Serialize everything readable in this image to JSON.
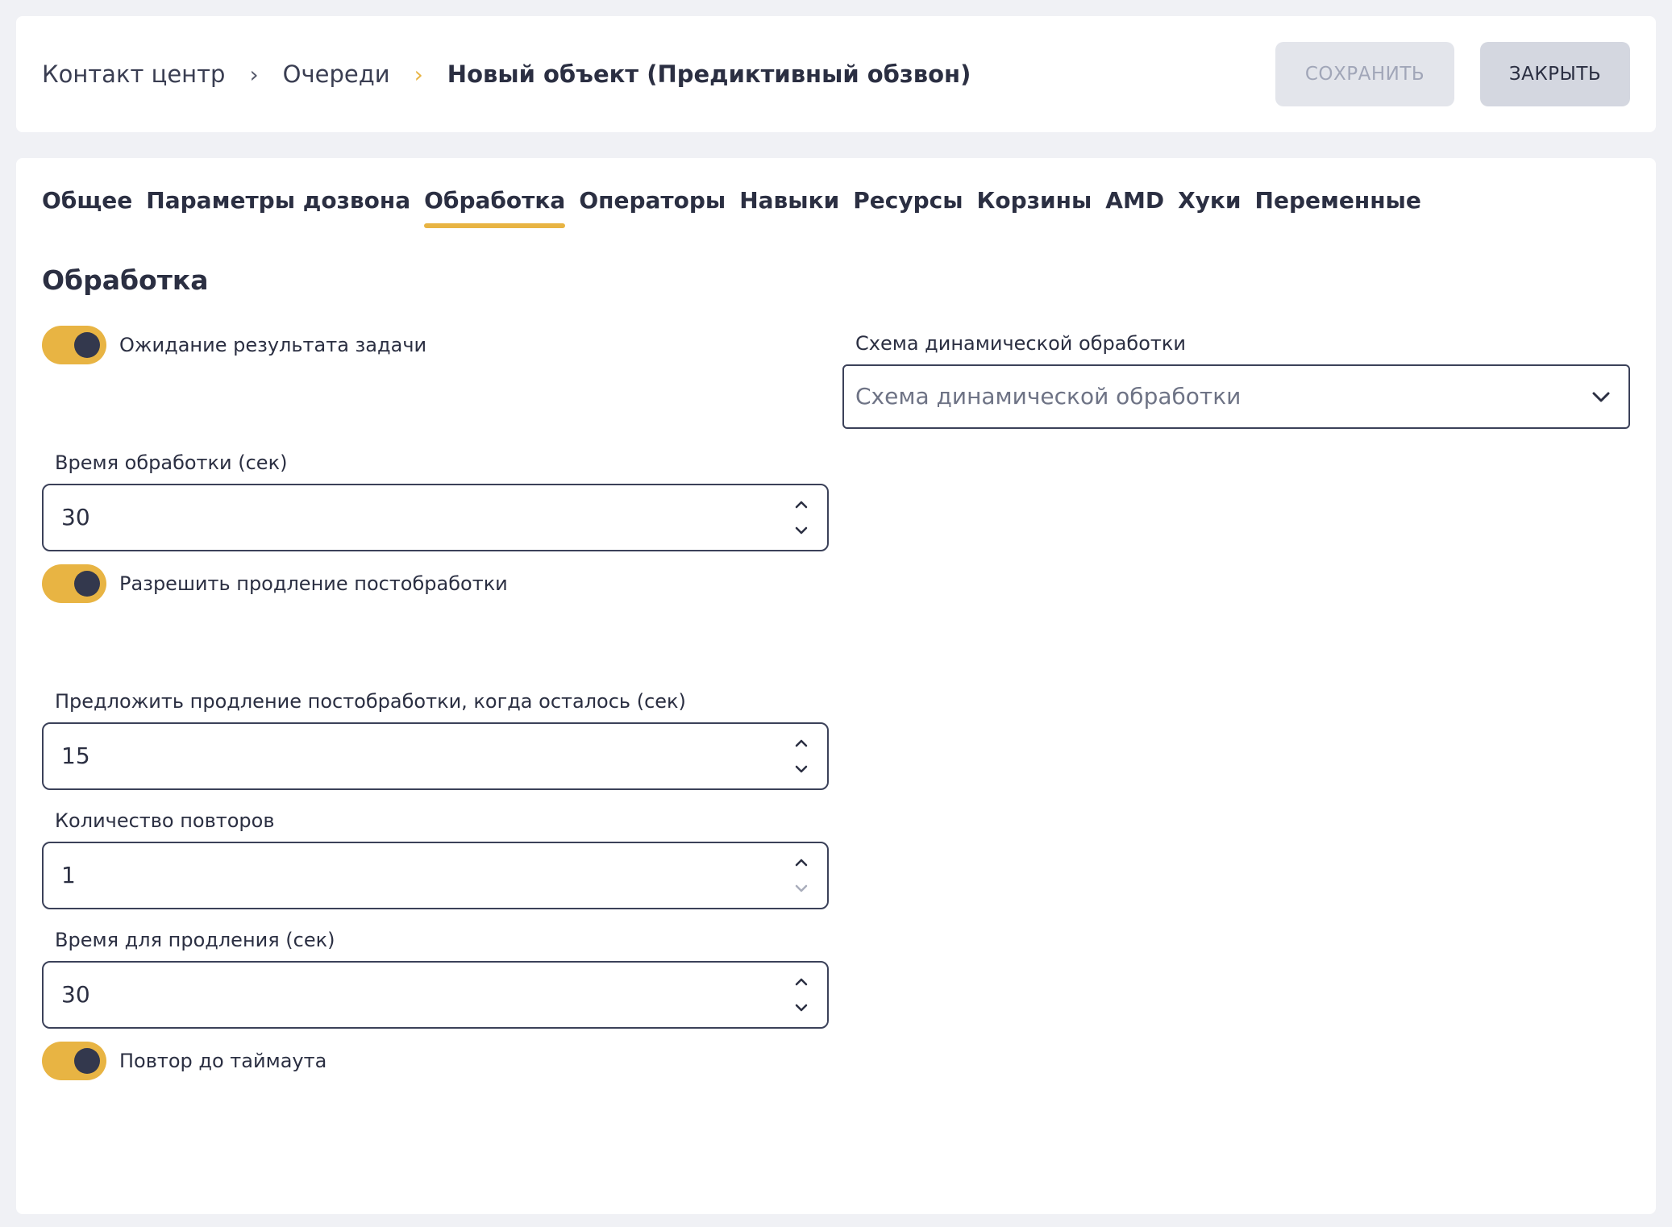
{
  "breadcrumb": {
    "items": [
      "Контакт центр",
      "Очереди"
    ],
    "current": "Новый объект (Предиктивный обзвон)",
    "separator": "›"
  },
  "toolbar": {
    "save_label": "СОХРАНИТЬ",
    "close_label": "ЗАКРЫТЬ"
  },
  "tabs": [
    {
      "label": "Общее",
      "active": false
    },
    {
      "label": "Параметры дозвона",
      "active": false
    },
    {
      "label": "Обработка",
      "active": true
    },
    {
      "label": "Операторы",
      "active": false
    },
    {
      "label": "Навыки",
      "active": false
    },
    {
      "label": "Ресурсы",
      "active": false
    },
    {
      "label": "Корзины",
      "active": false
    },
    {
      "label": "AMD",
      "active": false
    },
    {
      "label": "Хуки",
      "active": false
    },
    {
      "label": "Переменные",
      "active": false
    }
  ],
  "section": {
    "title": "Обработка"
  },
  "toggles": {
    "wait_result": {
      "label": "Ожидание результата задачи",
      "on": true
    },
    "allow_extension": {
      "label": "Разрешить продление постобработки",
      "on": true
    },
    "repeat_timeout": {
      "label": "Повтор до таймаута",
      "on": true
    }
  },
  "dynamic_scheme": {
    "label": "Схема динамической обработки",
    "placeholder": "Схема динамической обработки",
    "value": ""
  },
  "fields": {
    "processing_time": {
      "label": "Время обработки (сек)",
      "value": "30"
    },
    "offer_extension": {
      "label": "Предложить продление постобработки, когда осталось (сек)",
      "value": "15"
    },
    "repeat_count": {
      "label": "Количество повторов",
      "value": "1"
    },
    "extension_time": {
      "label": "Время для продления (сек)",
      "value": "30"
    }
  },
  "colors": {
    "accent": "#e8b443",
    "text": "#2b2f42",
    "background": "#f0f1f5",
    "button_disabled_bg": "#e3e5eb",
    "button_close_bg": "#d4d7e0",
    "input_border": "#3b4159"
  },
  "icons": {
    "separator": "chevron-right-icon",
    "select": "chevron-down-icon",
    "spinner_up": "chevron-up-icon",
    "spinner_down": "chevron-down-icon"
  }
}
